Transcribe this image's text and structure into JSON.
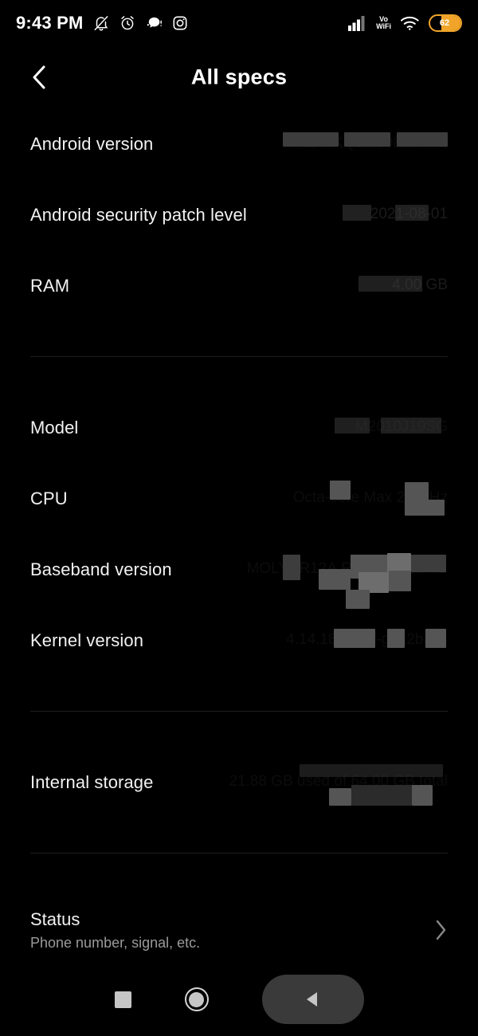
{
  "statusbar": {
    "time": "9:43 PM",
    "icons_left": [
      "bell-muted-icon",
      "alarm-clock-icon",
      "message-icon",
      "instagram-icon"
    ],
    "network_label": "Vo",
    "network_label2": "WiFi",
    "icons_right": [
      "signal-bars-icon",
      "vowifi-indicator",
      "wifi-icon",
      "battery-icon"
    ],
    "battery_percent": "62",
    "battery_color": "#f0a52a"
  },
  "header": {
    "back_icon": "chevron-left-icon",
    "title": "All specs"
  },
  "specs": {
    "group1": [
      {
        "label": "Android version",
        "value": "11 RKQ1.200826.002"
      },
      {
        "label": "Android security patch level",
        "value": "2021-08-01"
      },
      {
        "label": "RAM",
        "value": "4.00 GB"
      }
    ],
    "group2": [
      {
        "label": "Model",
        "value": "M2010J19SG"
      },
      {
        "label": "CPU",
        "value": "Octa-core Max 2.0GHz"
      },
      {
        "label": "Baseband version",
        "value": "MOLY.LR12A.R3.MP.V89.P71"
      },
      {
        "label": "Kernel version",
        "value": "4.14.186-perf-g1a2b3c4"
      }
    ],
    "group3": [
      {
        "label": "Internal storage",
        "value": "21.88 GB used of 64.00 GB total"
      }
    ]
  },
  "status_entry": {
    "title": "Status",
    "subtitle": "Phone number, signal, etc.",
    "chevron_icon": "chevron-right-icon"
  },
  "navbar": {
    "recents_icon": "square-recents-icon",
    "home_icon": "circle-home-icon",
    "back_icon": "triangle-back-icon"
  }
}
